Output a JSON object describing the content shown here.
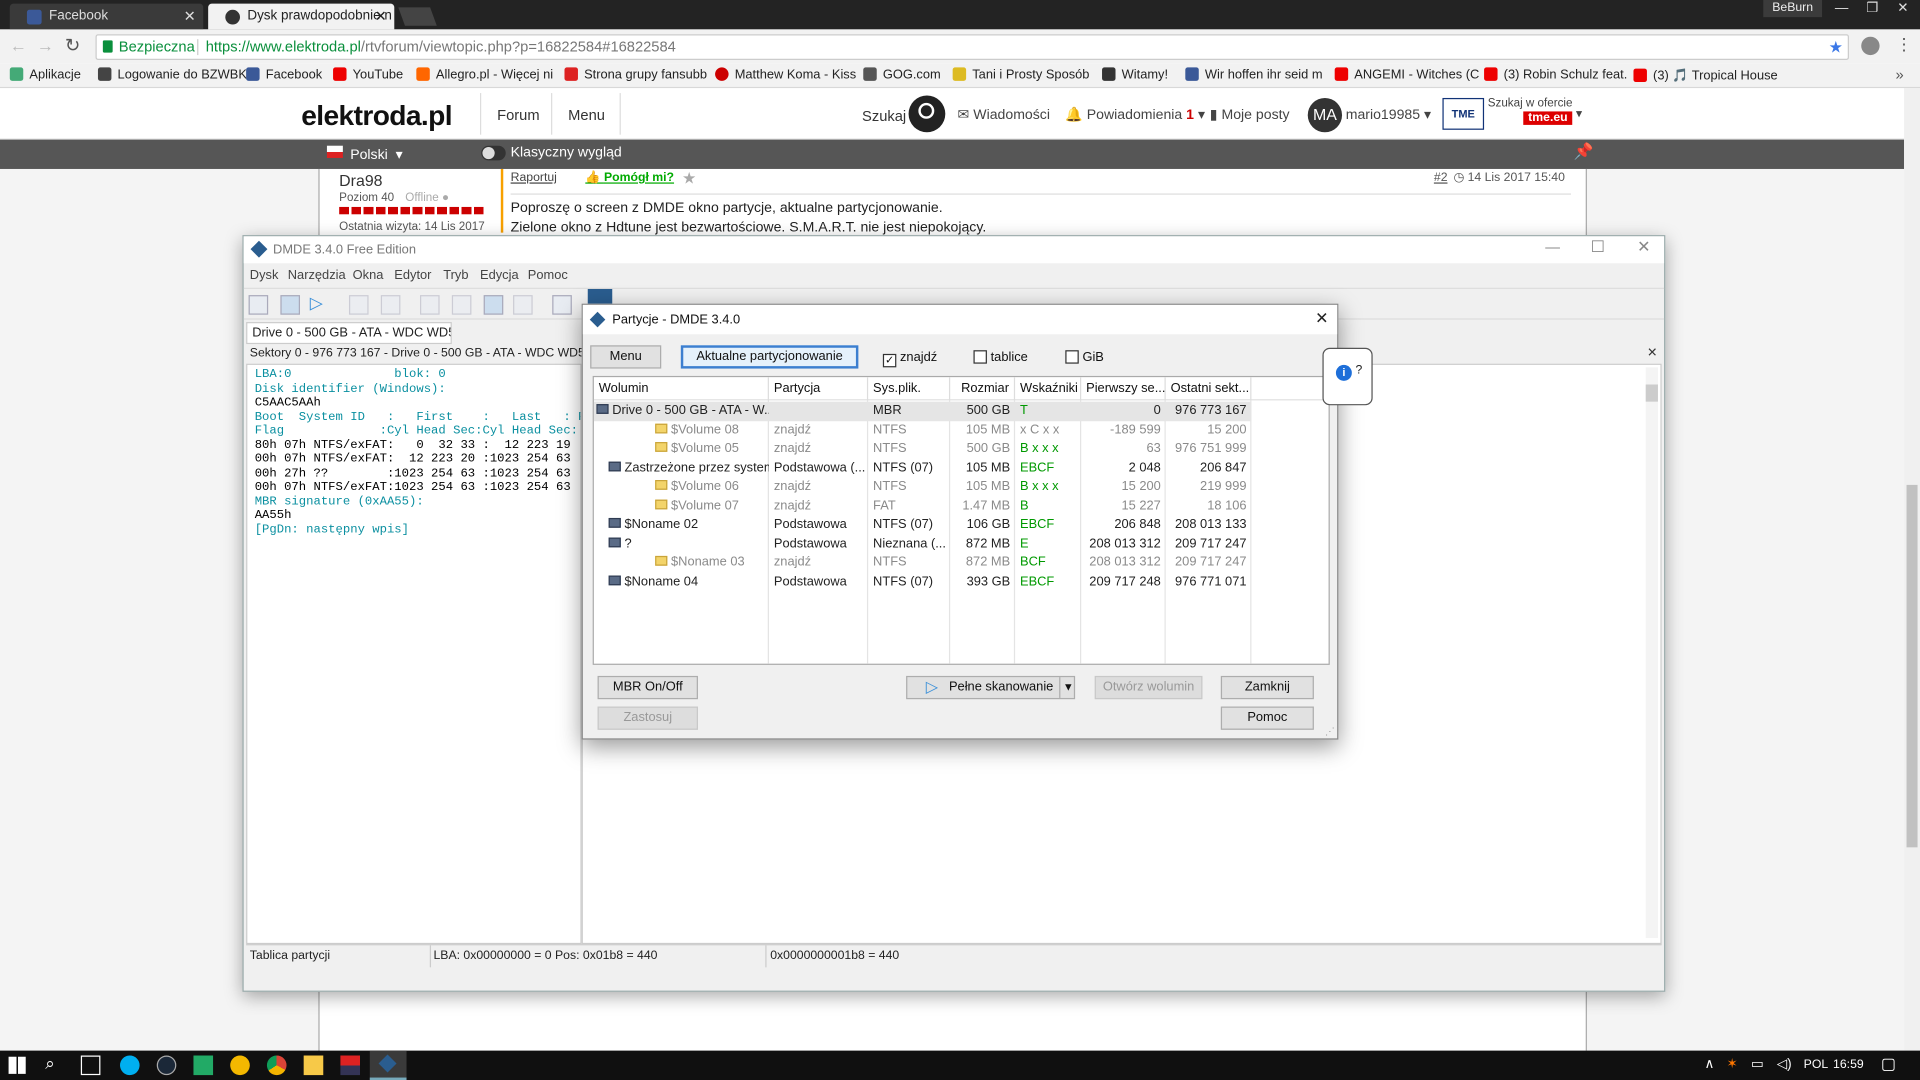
{
  "browser": {
    "tabs": [
      {
        "label": "Facebook",
        "active": false
      },
      {
        "label": "Dysk prawdopodobnie n",
        "active": true
      }
    ],
    "user": "BeBurn",
    "secure_label": "Bezpieczna",
    "url_host": "https://www.elektroda.pl",
    "url_path": "/rtvforum/viewtopic.php?p=16822584#16822584",
    "bookmarks": [
      {
        "label": "Aplikacje",
        "color": "#4a7"
      },
      {
        "label": "Logowanie do BZWBK",
        "color": "#444"
      },
      {
        "label": "Facebook",
        "color": "#3b5998"
      },
      {
        "label": "YouTube",
        "color": "#e00"
      },
      {
        "label": "Allegro.pl - Więcej ni",
        "color": "#f60"
      },
      {
        "label": "Strona grupy fansubb",
        "color": "#d22"
      },
      {
        "label": "Matthew Koma - Kiss",
        "color": "#c00"
      },
      {
        "label": "GOG.com",
        "color": "#555"
      },
      {
        "label": "Tani i Prosty Sposób",
        "color": "#db2"
      },
      {
        "label": "Witamy!",
        "color": "#333"
      },
      {
        "label": "Wir hoffen ihr seid m",
        "color": "#3b5998"
      },
      {
        "label": "ANGEMI - Witches (C",
        "color": "#e00"
      },
      {
        "label": "(3) Robin Schulz feat.",
        "color": "#e00"
      },
      {
        "label": "(3) 🎵 Tropical House",
        "color": "#e00"
      }
    ]
  },
  "site": {
    "logo": "elektroda.pl",
    "nav": [
      "Forum",
      "Menu"
    ],
    "search_label": "Szukaj",
    "messages": "Wiadomości",
    "notifications": "Powiadomienia",
    "notif_count": "1",
    "my_posts": "Moje posty",
    "avatar": "MA",
    "username": "mario19985",
    "tme_label": "Szukaj w ofercie",
    "tme_logo": "tme.eu",
    "lang": "Polski",
    "classic": "Klasyczny wygląd"
  },
  "post": {
    "author": "Dra98",
    "level": "Poziom 40",
    "status": "Offline",
    "last_visit": "Ostatnia wizyta: 14 Lis 2017",
    "report": "Raportuj",
    "helped": "Pomógł mi?",
    "num": "#2",
    "date": "14 Lis 2017 15:40",
    "line1": "Poproszę o screen z DMDE okno partycje, aktualne partycjonowanie.",
    "line2": "Zielone okno z Hdtune jest bezwartościowe. S.M.A.R.T. nie jest niepokojący."
  },
  "dmde": {
    "title": "DMDE 3.4.0 Free Edition",
    "menu": [
      "Dysk",
      "Narzędzia",
      "Okna",
      "Edytor",
      "Tryb",
      "Edycja",
      "Pomoc"
    ],
    "drive_tab": "Drive 0 - 500 GB - ATA - WDC WD50...",
    "sector_header": "Sektory 0 - 976 773 167 - Drive 0 - 500 GB - ATA - WDC WD5000A",
    "hex_lines": [
      "LBA:0              blok: 0",
      "Disk identifier (Windows):",
      "C5AAC5AAh",
      "Boot  System ID   :   First    :   Last   : F",
      "Flag             :Cyl Head Sec:Cyl Head Sec:",
      "80h 07h NTFS/exFAT:   0  32 33 :  12 223 19 :",
      "00h 07h NTFS/exFAT:  12 223 20 :1023 254 63 :",
      "00h 27h ??        :1023 254 63 :1023 254 63 : 2",
      "00h 07h NTFS/exFAT:1023 254 63 :1023 254 63 : 2",
      "MBR signature (0xAA55):",
      "AA55h",
      "[PgDn: następny wpis]"
    ],
    "status": {
      "left": "Tablica partycji",
      "mid": "LBA: 0x00000000 = 0  Pos: 0x01b8 = 440",
      "right": "0x0000000001b8 = 440"
    }
  },
  "dialog": {
    "title": "Partycje - DMDE 3.4.0",
    "menu_btn": "Menu",
    "current_btn": "Aktualne partycjonowanie",
    "checks": [
      {
        "label": "znajdź",
        "checked": true
      },
      {
        "label": "tablice",
        "checked": false
      },
      {
        "label": "GiB",
        "checked": false
      }
    ],
    "columns": [
      "Wolumin",
      "Partycja",
      "Sys.plik.",
      "Rozmiar",
      "Wskaźniki",
      "Pierwszy se...",
      "Ostatni sekt..."
    ],
    "rows": [
      {
        "name": "Drive 0 - 500 GB - ATA - W...",
        "part": "",
        "fs": "MBR",
        "size": "500 GB",
        "flags": "T",
        "first": "0",
        "last": "976 773 167",
        "grey": false,
        "indent": 0
      },
      {
        "name": "$Volume 08",
        "part": "znajdź",
        "fs": "NTFS",
        "size": "105 MB",
        "flags": "x C x x",
        "first": "-189 599",
        "last": "15 200",
        "grey": true,
        "indent": 3
      },
      {
        "name": "$Volume 05",
        "part": "znajdź",
        "fs": "NTFS",
        "size": "500 GB",
        "flags": "B x x x",
        "first": "63",
        "last": "976 751 999",
        "grey": true,
        "indent": 3
      },
      {
        "name": "Zastrzeżone przez system",
        "part": "Podstawowa (...",
        "fs": "NTFS (07)",
        "size": "105 MB",
        "flags": "EBCF",
        "first": "2 048",
        "last": "206 847",
        "grey": false,
        "indent": 1
      },
      {
        "name": "$Volume 06",
        "part": "znajdź",
        "fs": "NTFS",
        "size": "105 MB",
        "flags": "B x x x",
        "first": "15 200",
        "last": "219 999",
        "grey": true,
        "indent": 3
      },
      {
        "name": "$Volume 07",
        "part": "znajdź",
        "fs": "FAT",
        "size": "1.47 MB",
        "flags": "B",
        "first": "15 227",
        "last": "18 106",
        "grey": true,
        "indent": 3
      },
      {
        "name": "$Noname 02",
        "part": "Podstawowa",
        "fs": "NTFS (07)",
        "size": "106 GB",
        "flags": "EBCF",
        "first": "206 848",
        "last": "208 013 133",
        "grey": false,
        "indent": 1
      },
      {
        "name": "?",
        "part": "Podstawowa",
        "fs": "Nieznana (...",
        "size": "872 MB",
        "flags": "E",
        "first": "208 013 312",
        "last": "209 717 247",
        "grey": false,
        "indent": 1
      },
      {
        "name": "$Noname 03",
        "part": "znajdź",
        "fs": "NTFS",
        "size": "872 MB",
        "flags": "BCF",
        "first": "208 013 312",
        "last": "209 717 247",
        "grey": true,
        "indent": 3
      },
      {
        "name": "$Noname 04",
        "part": "Podstawowa",
        "fs": "NTFS (07)",
        "size": "393 GB",
        "flags": "EBCF",
        "first": "209 717 248",
        "last": "976 771 071",
        "grey": false,
        "indent": 1
      }
    ],
    "mbr_btn": "MBR On/Off",
    "apply_btn": "Zastosuj",
    "scan_btn": "Pełne skanowanie",
    "open_btn": "Otwórz wolumin",
    "close_btn": "Zamknij",
    "help_btn": "Pomoc",
    "help_bubble": "?"
  },
  "taskbar": {
    "lang": "POL",
    "time": "16:59"
  }
}
